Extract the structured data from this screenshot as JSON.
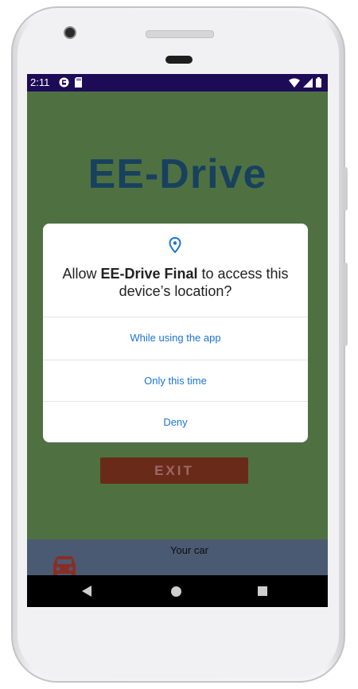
{
  "status_bar": {
    "time": "2:11",
    "left_icons": [
      "notification-icon",
      "sd-card-icon"
    ],
    "right_icons": [
      "wifi-icon",
      "signal-icon",
      "battery-icon"
    ]
  },
  "app": {
    "logo": "EE-Drive",
    "exit_label": "EXIT",
    "bottom_panel": {
      "label": "Your car",
      "icon": "car-icon"
    }
  },
  "dialog": {
    "icon": "location-pin-icon",
    "title_prefix": "Allow ",
    "title_app": "EE-Drive Final",
    "title_suffix": " to access this device’s location?",
    "options": [
      {
        "label": "While using the app"
      },
      {
        "label": "Only this time"
      },
      {
        "label": "Deny"
      }
    ]
  },
  "navigation": {
    "buttons": [
      "back",
      "home",
      "recents"
    ]
  },
  "colors": {
    "status_bar": "#1d0b57",
    "app_background": "#4f7141",
    "logo": "#17415e",
    "exit_button": "#6a2a1a",
    "dialog_accent": "#1a73d9",
    "car_icon": "#8a2d24"
  }
}
